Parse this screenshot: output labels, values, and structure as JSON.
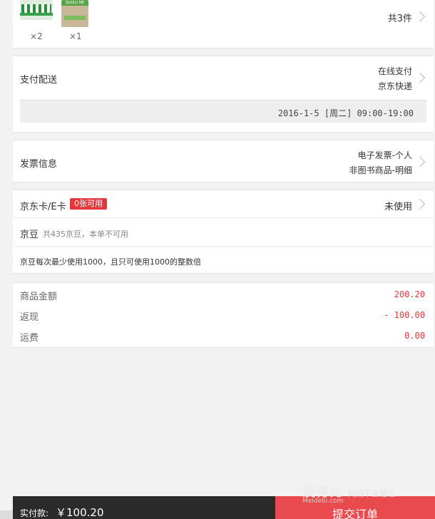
{
  "products": {
    "items": [
      {
        "qty": "×2",
        "icon": "product-thumbnail-icon"
      },
      {
        "qty": "×1",
        "icon": "product-thumbnail-icon",
        "package_text": "SUOLU ME"
      }
    ],
    "total": "共3件"
  },
  "delivery": {
    "label": "支付配送",
    "payment": "在线支付",
    "shipping": "京东快递",
    "time": "2016-1-5 [周二] 09:00-19:00"
  },
  "invoice": {
    "label": "发票信息",
    "type": "电子发票-个人",
    "content": "非图书商品-明细"
  },
  "jdcard": {
    "label": "京东卡/E卡",
    "badge": "0张可用",
    "status": "未使用"
  },
  "beans": {
    "label": "京豆",
    "note": "共435京豆，本单不可用",
    "rule": "京豆每次最少使用1000，且只可使用1000的整数倍"
  },
  "amounts": {
    "goods_label": "商品金额",
    "goods_value": "200.20",
    "rebate_label": "返现",
    "rebate_value": "- 100.00",
    "shipping_label": "运费",
    "shipping_value": "0.00"
  },
  "footer": {
    "pay_label": "实付款:",
    "pay_amount": "￥100.20",
    "submit_label": "提交订单"
  },
  "watermark": {
    "brand": "没得比",
    "url": "Meidebi.com",
    "side": "网购不会错过"
  },
  "colors": {
    "accent": "#e4393c",
    "submit": "#e94a4d",
    "footer_bg": "#2b2b2b"
  }
}
